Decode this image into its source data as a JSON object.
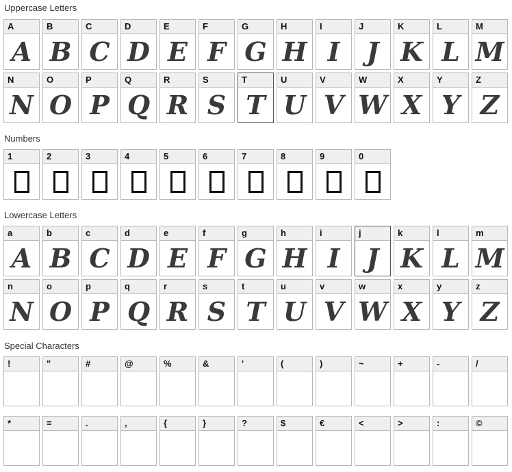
{
  "sections": {
    "uppercase": {
      "title": "Uppercase Letters",
      "rows": [
        [
          {
            "label": "A",
            "glyph": "A"
          },
          {
            "label": "B",
            "glyph": "B"
          },
          {
            "label": "C",
            "glyph": "C"
          },
          {
            "label": "D",
            "glyph": "D"
          },
          {
            "label": "E",
            "glyph": "E"
          },
          {
            "label": "F",
            "glyph": "F"
          },
          {
            "label": "G",
            "glyph": "G"
          },
          {
            "label": "H",
            "glyph": "H"
          },
          {
            "label": "I",
            "glyph": "I"
          },
          {
            "label": "J",
            "glyph": "J"
          },
          {
            "label": "K",
            "glyph": "K"
          },
          {
            "label": "L",
            "glyph": "L"
          },
          {
            "label": "M",
            "glyph": "M"
          }
        ],
        [
          {
            "label": "N",
            "glyph": "N"
          },
          {
            "label": "O",
            "glyph": "O"
          },
          {
            "label": "P",
            "glyph": "P"
          },
          {
            "label": "Q",
            "glyph": "Q"
          },
          {
            "label": "R",
            "glyph": "R"
          },
          {
            "label": "S",
            "glyph": "S"
          },
          {
            "label": "T",
            "glyph": "T"
          },
          {
            "label": "U",
            "glyph": "U"
          },
          {
            "label": "V",
            "glyph": "V"
          },
          {
            "label": "W",
            "glyph": "W"
          },
          {
            "label": "X",
            "glyph": "X"
          },
          {
            "label": "Y",
            "glyph": "Y"
          },
          {
            "label": "Z",
            "glyph": "Z"
          }
        ]
      ]
    },
    "numbers": {
      "title": "Numbers",
      "rows": [
        [
          {
            "label": "1"
          },
          {
            "label": "2"
          },
          {
            "label": "3"
          },
          {
            "label": "4"
          },
          {
            "label": "5"
          },
          {
            "label": "6"
          },
          {
            "label": "7"
          },
          {
            "label": "8"
          },
          {
            "label": "9"
          },
          {
            "label": "0"
          }
        ]
      ]
    },
    "lowercase": {
      "title": "Lowercase Letters",
      "rows": [
        [
          {
            "label": "a",
            "glyph": "A"
          },
          {
            "label": "b",
            "glyph": "B"
          },
          {
            "label": "c",
            "glyph": "C"
          },
          {
            "label": "d",
            "glyph": "D"
          },
          {
            "label": "e",
            "glyph": "E"
          },
          {
            "label": "f",
            "glyph": "F"
          },
          {
            "label": "g",
            "glyph": "G"
          },
          {
            "label": "h",
            "glyph": "H"
          },
          {
            "label": "i",
            "glyph": "I"
          },
          {
            "label": "j",
            "glyph": "J"
          },
          {
            "label": "k",
            "glyph": "K"
          },
          {
            "label": "l",
            "glyph": "L"
          },
          {
            "label": "m",
            "glyph": "M"
          }
        ],
        [
          {
            "label": "n",
            "glyph": "N"
          },
          {
            "label": "o",
            "glyph": "O"
          },
          {
            "label": "p",
            "glyph": "P"
          },
          {
            "label": "q",
            "glyph": "Q"
          },
          {
            "label": "r",
            "glyph": "R"
          },
          {
            "label": "s",
            "glyph": "S"
          },
          {
            "label": "t",
            "glyph": "T"
          },
          {
            "label": "u",
            "glyph": "U"
          },
          {
            "label": "v",
            "glyph": "V"
          },
          {
            "label": "w",
            "glyph": "W"
          },
          {
            "label": "x",
            "glyph": "X"
          },
          {
            "label": "y",
            "glyph": "Y"
          },
          {
            "label": "z",
            "glyph": "Z"
          }
        ]
      ]
    },
    "special": {
      "title": "Special Characters",
      "rows": [
        [
          {
            "label": "!"
          },
          {
            "label": "\""
          },
          {
            "label": "#"
          },
          {
            "label": "@"
          },
          {
            "label": "%"
          },
          {
            "label": "&"
          },
          {
            "label": "'"
          },
          {
            "label": "("
          },
          {
            "label": ")"
          },
          {
            "label": "~"
          },
          {
            "label": "+"
          },
          {
            "label": "-"
          },
          {
            "label": "/"
          }
        ],
        [
          {
            "label": "*"
          },
          {
            "label": "="
          },
          {
            "label": "."
          },
          {
            "label": ","
          },
          {
            "label": "{"
          },
          {
            "label": "}"
          },
          {
            "label": "?"
          },
          {
            "label": "$"
          },
          {
            "label": "€"
          },
          {
            "label": "<"
          },
          {
            "label": ">"
          },
          {
            "label": ":"
          },
          {
            "label": "©"
          }
        ]
      ]
    }
  }
}
